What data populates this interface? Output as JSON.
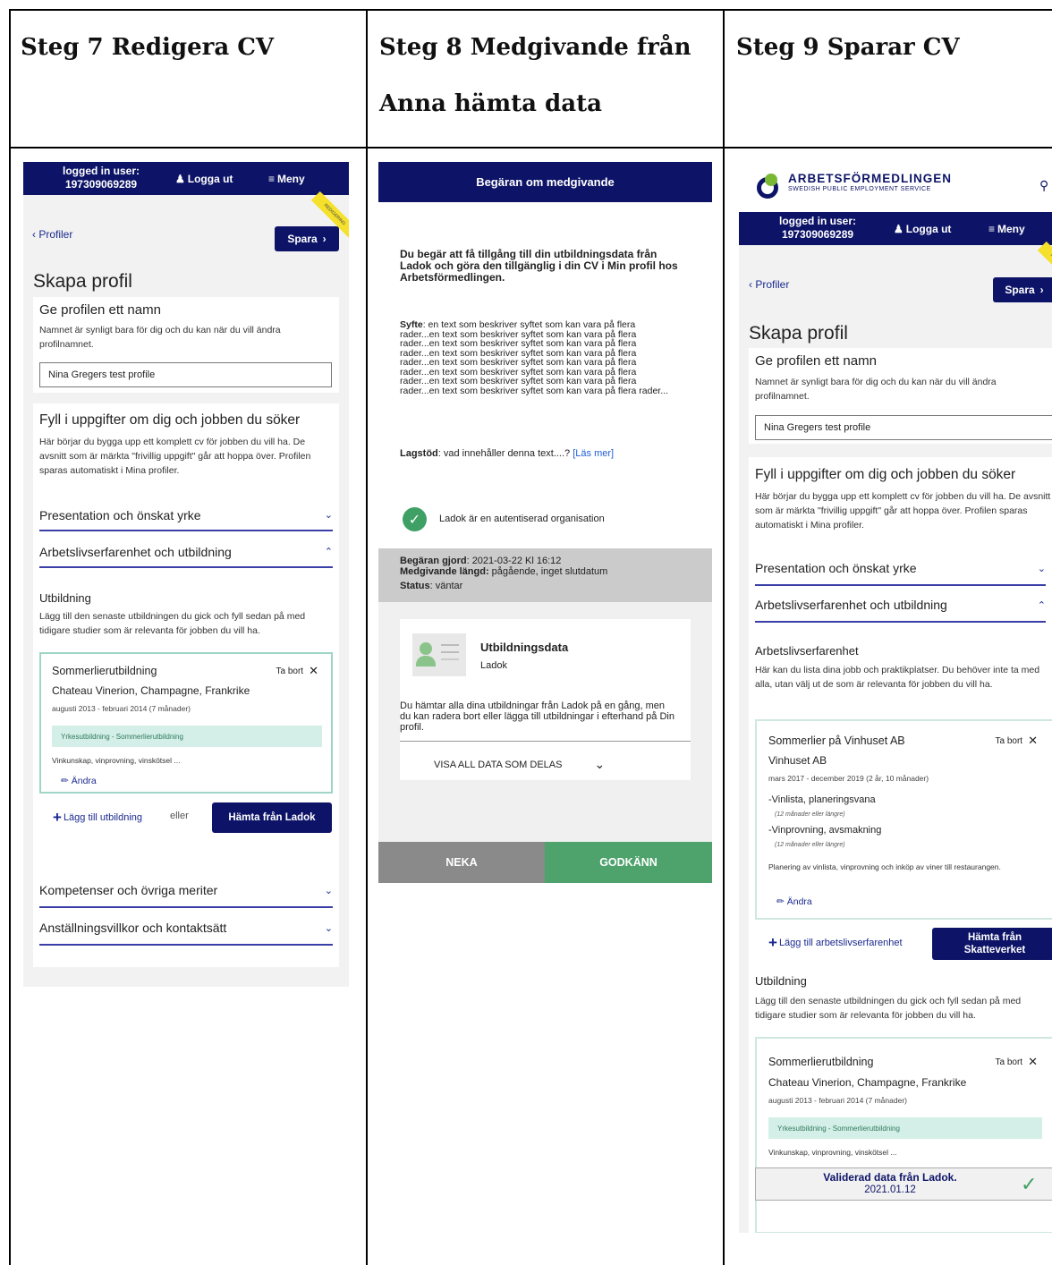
{
  "columns": [
    {
      "heading": "Steg 7 Redigera CV"
    },
    {
      "heading_line1": "Steg 8 Medgivande från",
      "heading_line2": "Anna hämta data"
    },
    {
      "heading": "Steg 9 Sparar CV"
    }
  ],
  "common": {
    "logged_in_label": "logged in user:",
    "user_id": "197309069289",
    "logout_label": "Logga ut",
    "menu_label": "Meny",
    "back_label": "Profiler",
    "save_label": "Spara",
    "page_title": "Skapa profil",
    "name_section_title": "Ge profilen ett namn",
    "name_section_text": "Namnet är synligt bara för dig och du kan när du vill ändra profilnamnet.",
    "profile_name_value": "Nina Gregers test profile",
    "fill_title": "Fyll i uppgifter om dig och jobben du söker",
    "fill_text": "Här börjar du bygga upp ett komplett cv för jobben du vill ha. De avsnitt som är märkta \"frivillig uppgift\" går att hoppa över. Profilen sparas automatiskt i Mina profiler.",
    "acc_presentation": "Presentation och önskat yrke",
    "acc_work": "Arbetslivserfarenhet och utbildning",
    "edu_title": "Utbildning",
    "edu_text": "Lägg till den senaste utbildningen du gick och fyll sedan på med tidigare studier som är relevanta för jobben du vill ha.",
    "edu_item_title": "Sommerlierutbildning",
    "remove_label": "Ta bort",
    "edu_item_school": "Chateau Vinerion, Champagne, Frankrike",
    "edu_item_dates": "augusti 2013 - februari 2014 (7 månader)",
    "edu_item_tag": "Yrkesutbildning - Sommerlierutbildning",
    "edu_item_desc": "Vinkunskap, vinprovning, vinskötsel ...",
    "edit_label": "Ändra",
    "draft_ribbon": "REDIGERING"
  },
  "steg7": {
    "add_edu_label": "Lägg till utbildning",
    "or_label": "eller",
    "fetch_ladok_label": "Hämta från Ladok",
    "acc_competence": "Kompetenser och övriga meriter",
    "acc_conditions": "Anställningsvillkor och kontaktsätt"
  },
  "steg8": {
    "header": "Begäran om medgivande",
    "intro": "Du begär att få tillgång till din utbildningsdata från Ladok och göra den tillgänglig i din CV i Min profil hos Arbetsförmedlingen.",
    "purpose_label": "Syfte",
    "purpose_text": ": en text som beskriver syftet som kan vara på flera rader...en text som beskriver syftet som kan vara på flera rader...en text som beskriver syftet som kan vara på flera rader...en text som beskriver syftet som kan vara på flera rader...en text som beskriver syftet som kan vara på flera rader...en text som beskriver syftet som kan vara på flera rader...en text som beskriver syftet som kan vara på flera rader...en text som beskriver syftet som kan vara på flera rader...",
    "legal_label": "Lagstöd",
    "legal_text": ": vad innehåller denna text....? ",
    "read_more": "[Läs mer]",
    "auth_text": "Ladok är en autentiserad organisation",
    "request_label": "Begäran gjord",
    "request_value": ": 2021-03-22 Kl 16:12",
    "duration_label": "Medgivande längd:",
    "duration_value": " pågående, inget slutdatum",
    "status_label": "Status",
    "status_value": ": väntar",
    "data_title": "Utbildningsdata",
    "data_source": "Ladok",
    "data_text": "Du hämtar alla dina utbildningar från Ladok på en gång, men du kan radera bort eller lägga till utbildningar i efterhand på Din profil.",
    "show_all": "VISA ALL DATA SOM DELAS",
    "deny": "NEKA",
    "approve": "GODKÄNN"
  },
  "steg9": {
    "brand": "ARBETSFÖRMEDLINGEN",
    "brand_sub": "SWEDISH PUBLIC EMPLOYMENT SERVICE",
    "work_title": "Arbetslivserfarenhet",
    "work_text": "Här kan du lista dina jobb och praktikplatser. Du behöver inte ta med alla, utan välj ut de som är relevanta för jobben du vill ha.",
    "job_title": "Sommerlier på Vinhuset AB",
    "job_company": "Vinhuset AB",
    "job_dates": "mars 2017 - december 2019 (2 år, 10 månader)",
    "skill1": "-Vinlista, planeringsvana",
    "skill1_note": "(12 månader eller längre)",
    "skill2": "-Vinprovning, avsmakning",
    "skill2_note": "(12 månader eller längre)",
    "job_desc": "Planering av vinlista, vinprovning och inköp av viner till restaurangen.",
    "add_work_label": "Lägg till arbetslivserfarenhet",
    "fetch_tax_label_1": "Hämta från",
    "fetch_tax_label_2": "Skatteverket",
    "validated_label": "Validerad data från Ladok.",
    "validated_date": "2021.01.12"
  }
}
